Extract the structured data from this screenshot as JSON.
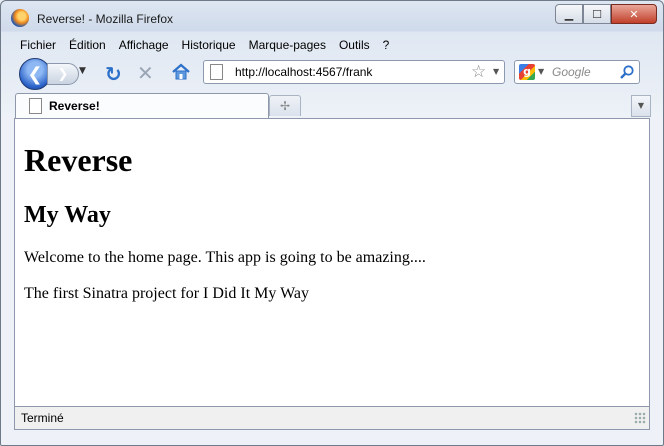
{
  "window": {
    "title": "Reverse! - Mozilla Firefox"
  },
  "menu": {
    "items": [
      {
        "label": "Fichier"
      },
      {
        "label": "Édition"
      },
      {
        "label": "Affichage"
      },
      {
        "label": "Historique"
      },
      {
        "label": "Marque-pages"
      },
      {
        "label": "Outils"
      },
      {
        "label": "?"
      }
    ]
  },
  "navigation": {
    "url": "http://localhost:4567/frank",
    "search_placeholder": "Google"
  },
  "tab": {
    "label": "Reverse!"
  },
  "page": {
    "h1": "Reverse",
    "h2": "My Way",
    "p1": "Welcome to the home page. This app is going to be amazing....",
    "p2": "The first Sinatra project for I Did It My Way"
  },
  "status": {
    "text": "Terminé"
  },
  "colors": {
    "accent": "#2b62c9",
    "close": "#c0402a"
  }
}
